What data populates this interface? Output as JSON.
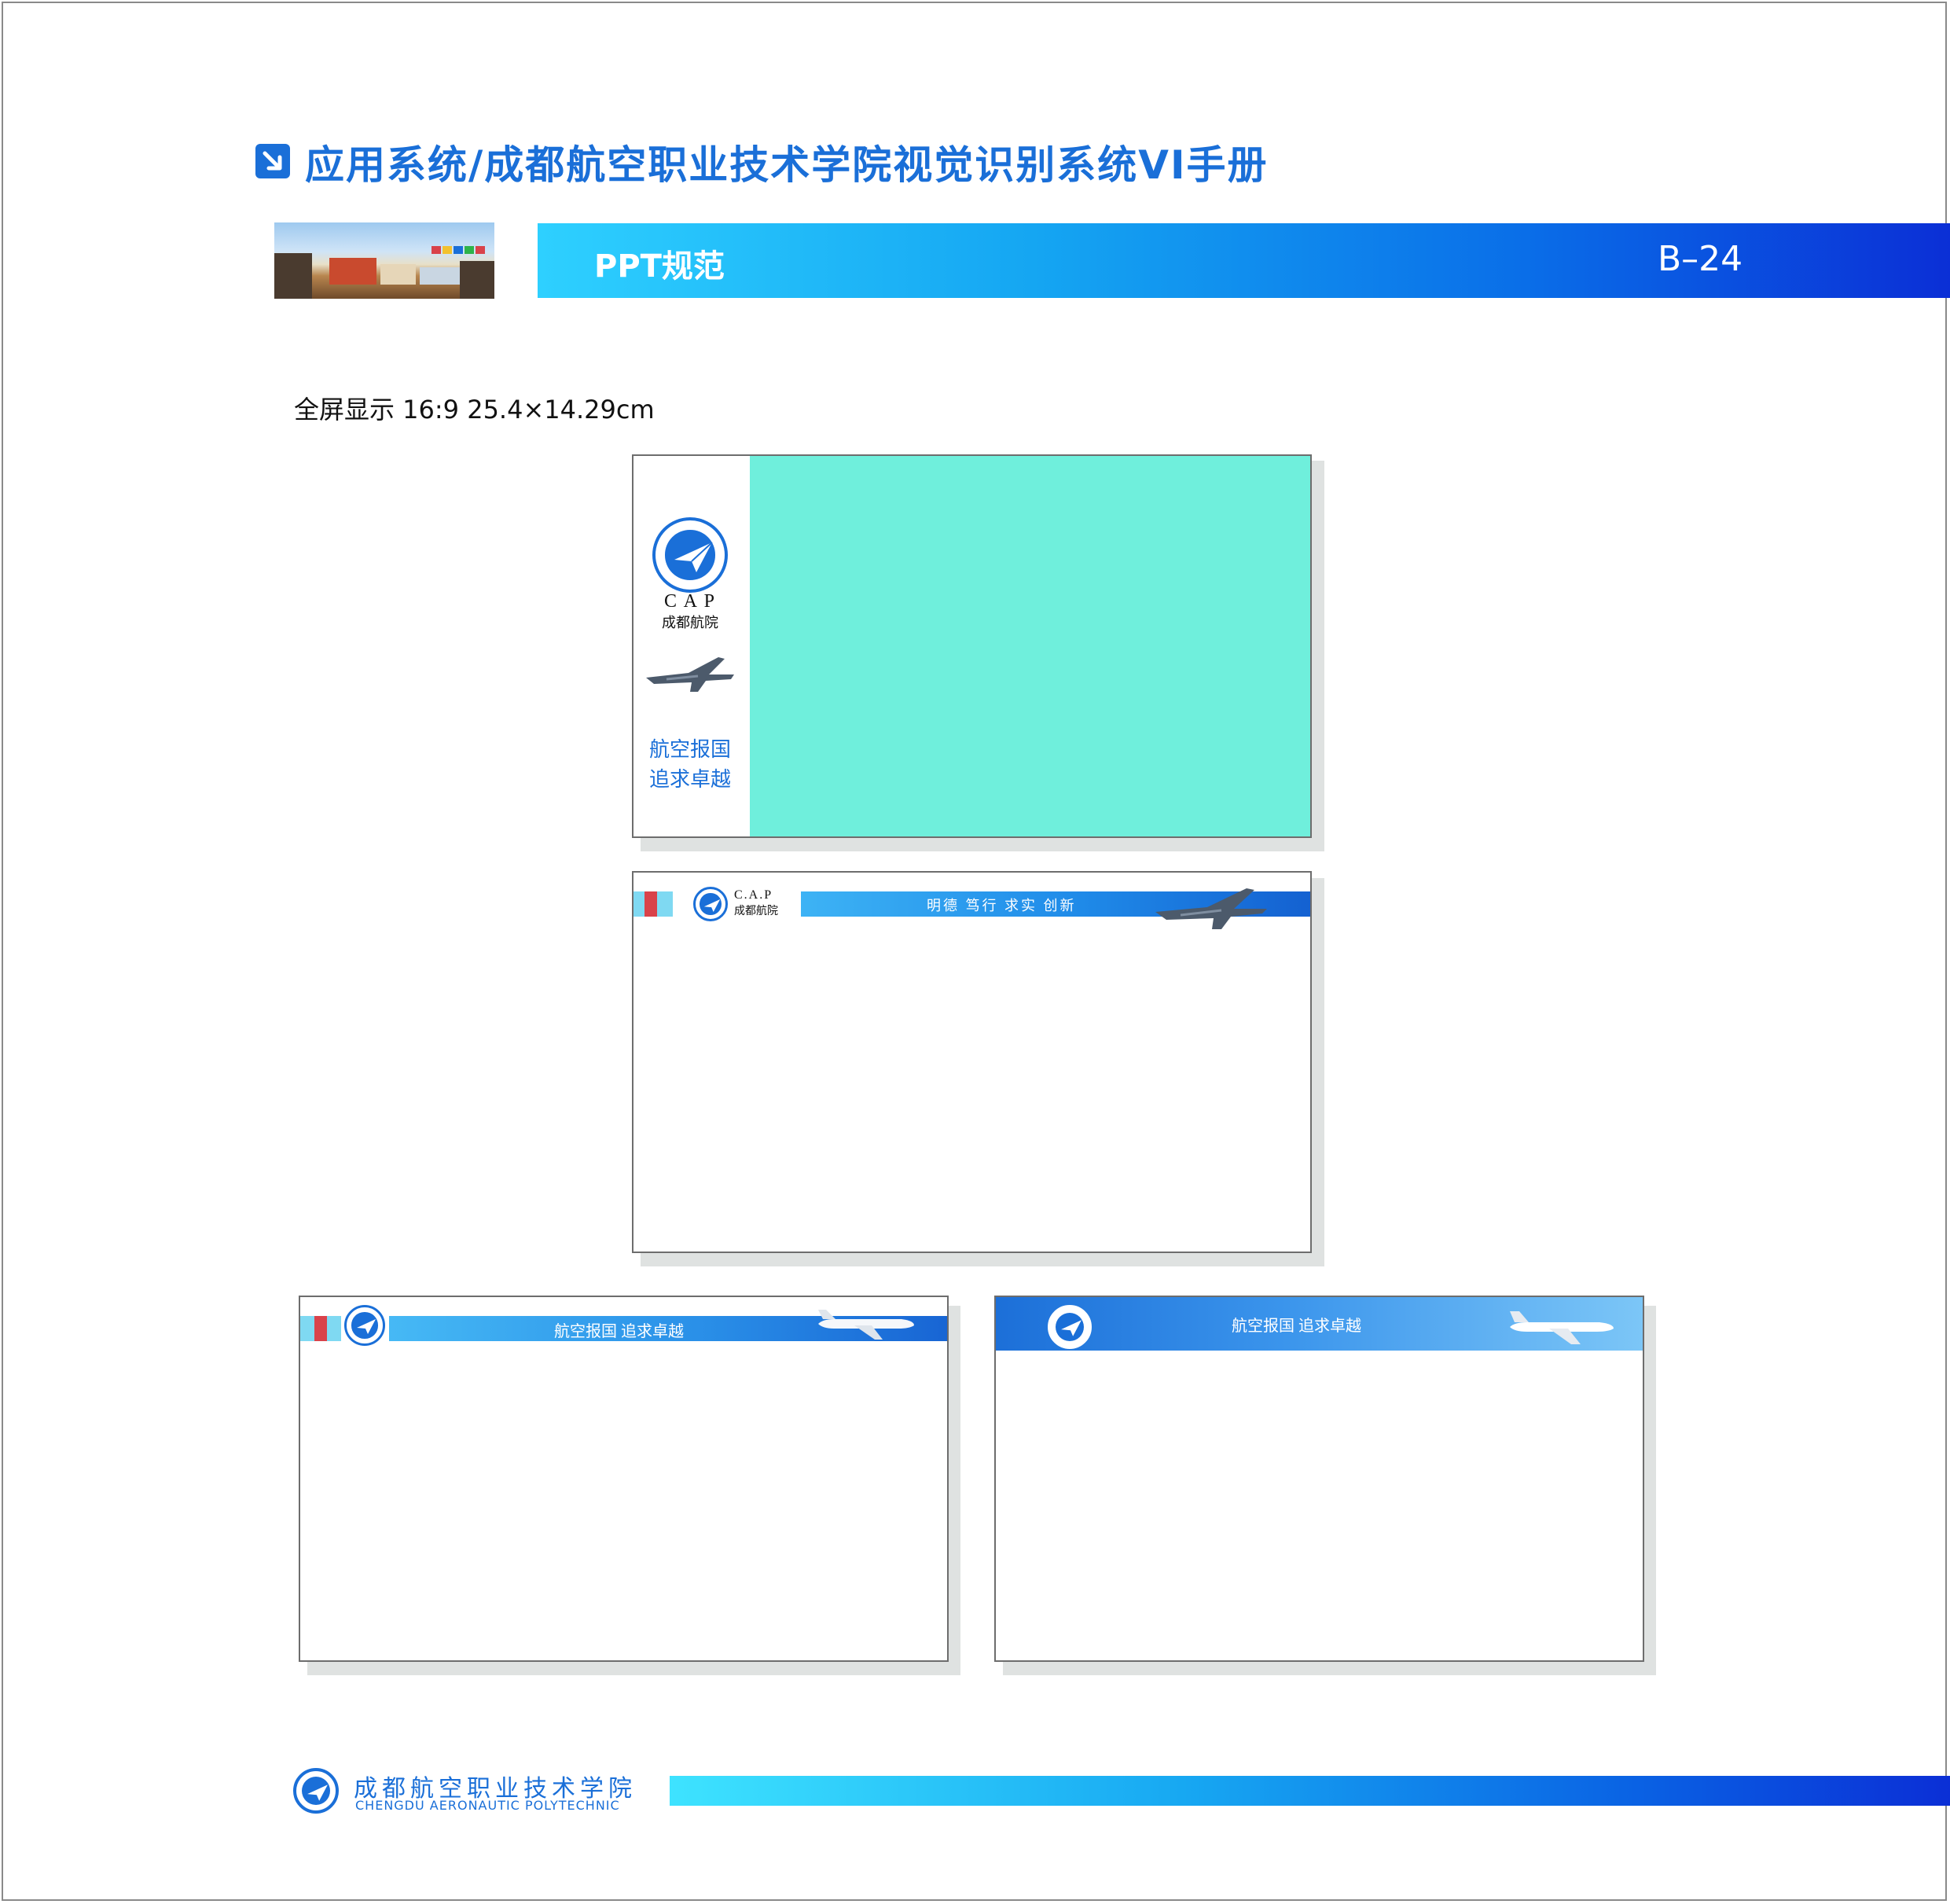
{
  "header": {
    "title": "应用系统/成都航空职业技术学院视觉识别系统VI手册",
    "icon": "arrow-down-right-icon"
  },
  "section": {
    "title": "PPT规范",
    "page_code": "B–24"
  },
  "spec": {
    "text": "全屏显示 16:9   25.4×14.29cm"
  },
  "slides": {
    "s1": {
      "cap": "C A P",
      "cap_cn": "成都航院",
      "slogan_line1": "航空报国",
      "slogan_line2": "追求卓越"
    },
    "s2": {
      "cap": "C.A.P",
      "cap_cn": "成都航院",
      "motto": "明德  笃行  求实  创新"
    },
    "s3": {
      "slogan": "航空报国  追求卓越"
    },
    "s4": {
      "slogan": "航空报国    追求卓越"
    }
  },
  "footer": {
    "name_cn": "成都航空职业技术学院",
    "name_en": "CHENGDU AERONAUTIC POLYTECHNIC"
  },
  "colors": {
    "brand_blue": "#1a6fd8",
    "accent_cyan": "#2ed0ff",
    "panel_turquoise": "#6fefdc",
    "stripe_red": "#d9424a",
    "stripe_cyan": "#7fd9f2"
  }
}
